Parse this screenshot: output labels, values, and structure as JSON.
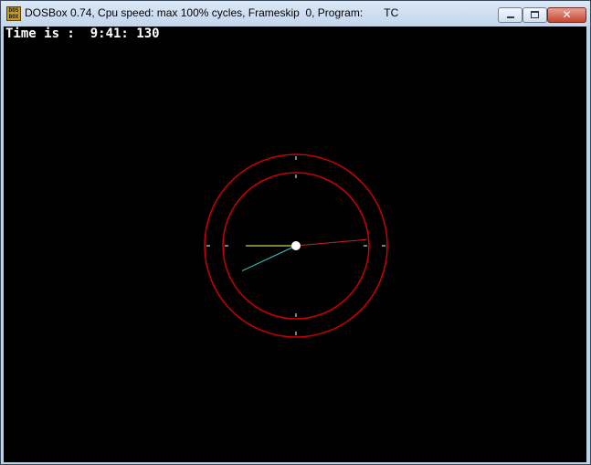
{
  "window": {
    "title": "DOSBox 0.74, Cpu speed: max 100% cycles, Frameskip  0, Program:       TC",
    "icon": "dosbox-icon",
    "icon_text": "DOS\nBOX",
    "buttons": {
      "minimize": "minimize-icon",
      "maximize": "maximize-icon",
      "close": "close-icon",
      "close_glyph": "✕"
    }
  },
  "screen": {
    "background": "#000000",
    "time_text": "Time is :  9:41: 130"
  },
  "clock": {
    "hour": 9,
    "minute": 41,
    "second": 13,
    "ring_color": "#cc0000",
    "tick_color": "#ffffff",
    "center_color": "#ffffff",
    "hands": [
      {
        "name": "hour-hand",
        "color": "#ffff66"
      },
      {
        "name": "minute-hand",
        "color": "#33cccc"
      },
      {
        "name": "second-hand",
        "color": "#cc2222"
      }
    ]
  }
}
